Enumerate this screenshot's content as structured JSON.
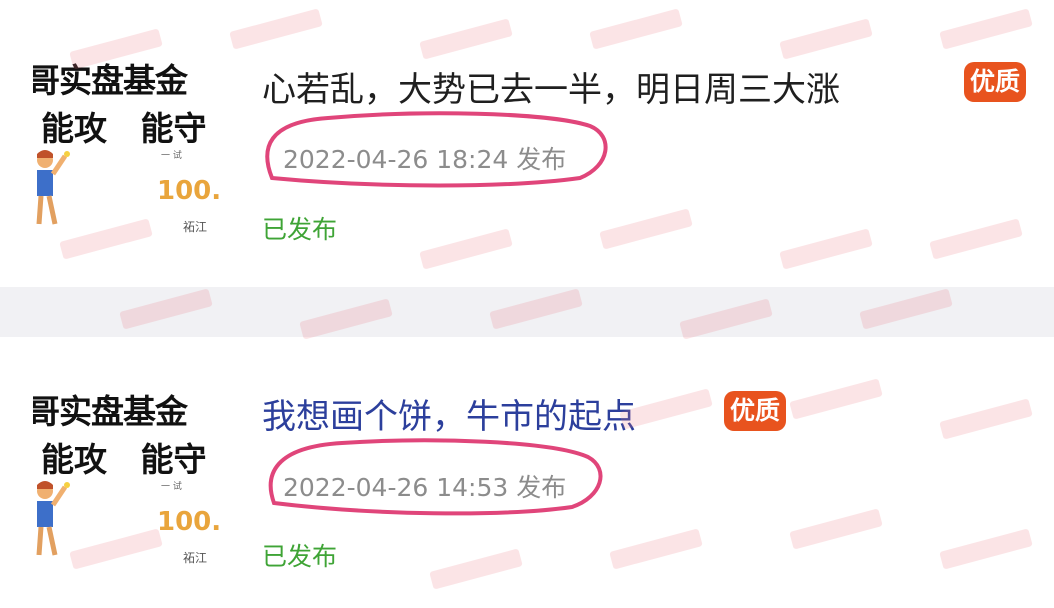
{
  "posts": [
    {
      "thumbnail": {
        "line1": "哥实盘基金",
        "line2": "能攻 能守",
        "small_text": "一 试",
        "number": "100.",
        "small_text2": "祏江"
      },
      "title": "心若乱，大势已去一半，明日周三大涨",
      "badge": "优质",
      "published": "2022-04-26 18:24 发布",
      "status": "已发布"
    },
    {
      "thumbnail": {
        "line1": "哥实盘基金",
        "line2": "能攻 能守",
        "small_text": "一 试",
        "number": "100.",
        "small_text2": "祏江"
      },
      "title": "我想画个饼，牛市的起点",
      "badge": "优质",
      "published": "2022-04-26 14:53 发布",
      "status": "已发布"
    }
  ],
  "colors": {
    "badge_bg": "#e8531e",
    "status_green": "#3fa436",
    "date_gray": "#8c8c8c",
    "highlight_ellipse": "#e0457a",
    "link_blue": "#2c3f9c"
  }
}
